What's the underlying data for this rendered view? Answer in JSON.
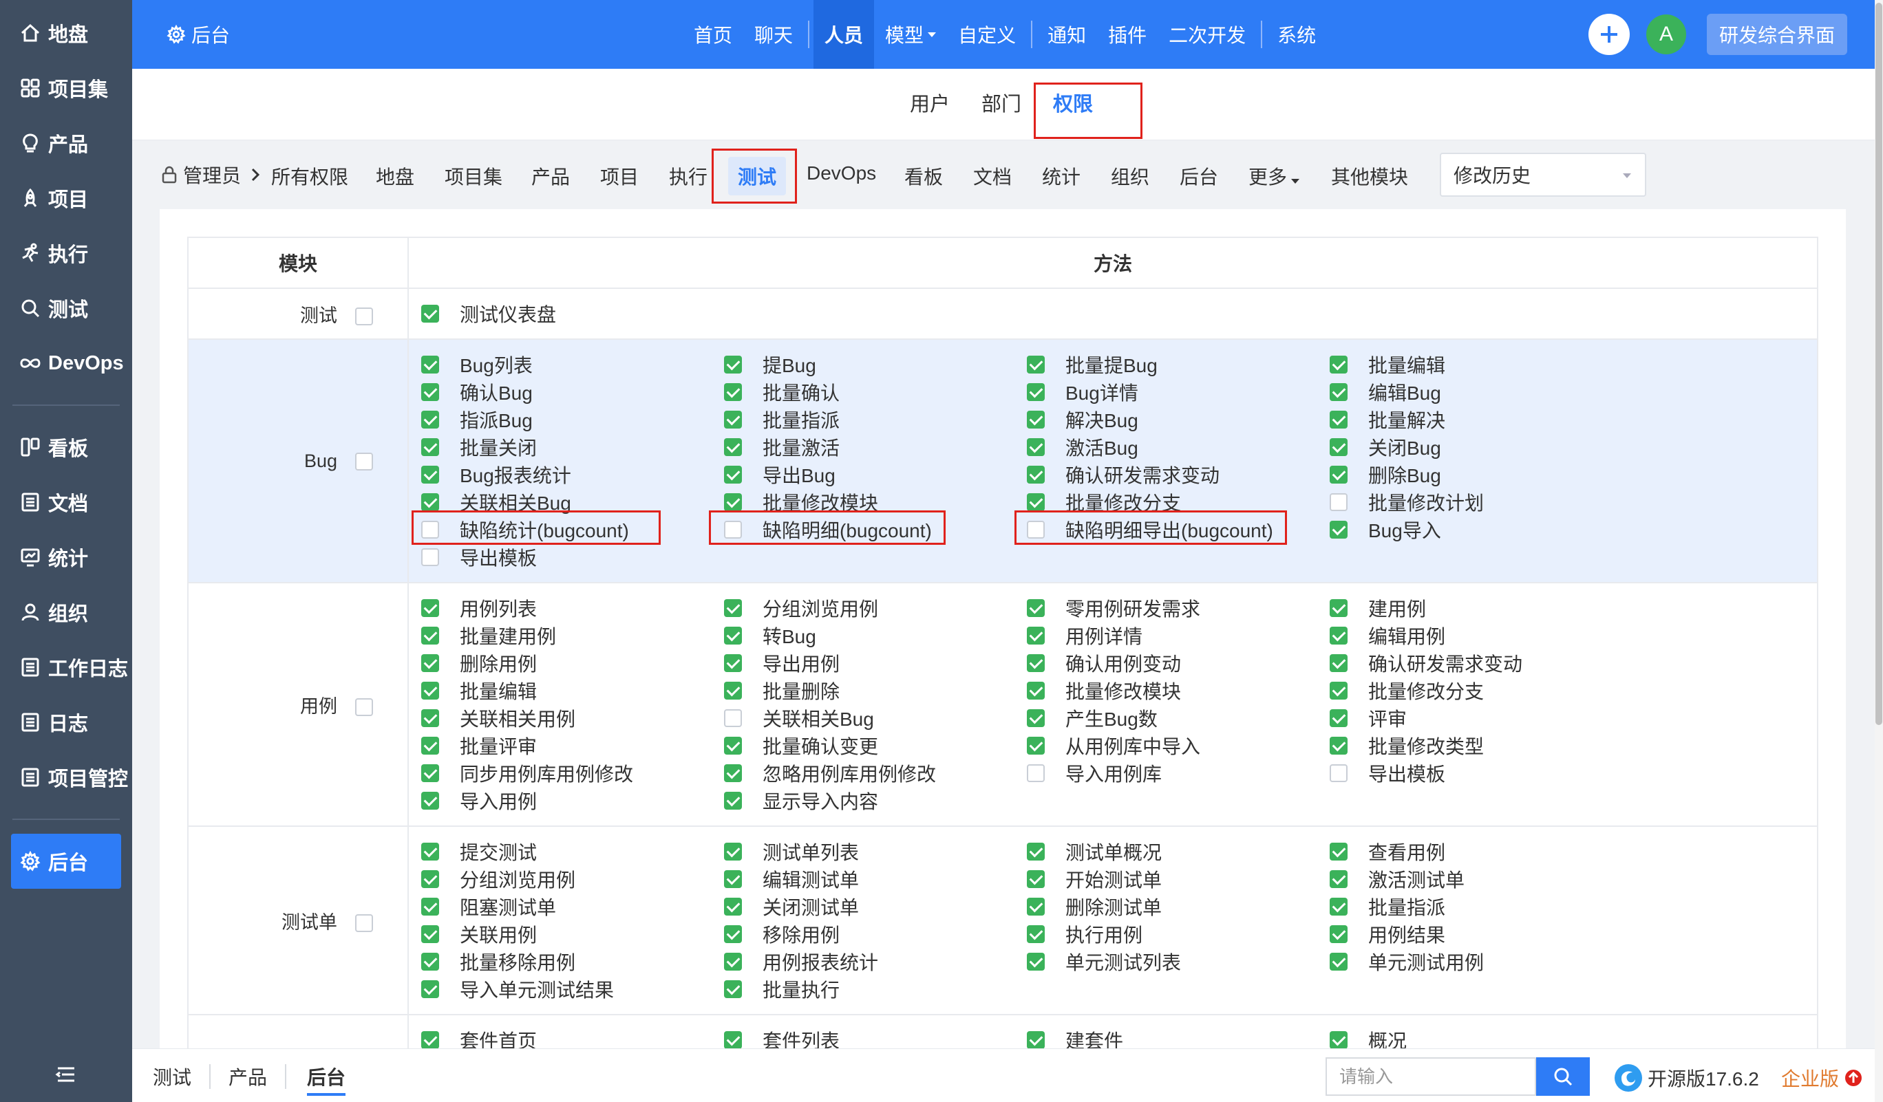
{
  "sidebar": {
    "items": [
      {
        "label": "地盘",
        "icon": "home-icon"
      },
      {
        "label": "项目集",
        "icon": "grid-icon"
      },
      {
        "label": "产品",
        "icon": "lightbulb-icon"
      },
      {
        "label": "项目",
        "icon": "project-icon"
      },
      {
        "label": "执行",
        "icon": "run-icon"
      },
      {
        "label": "测试",
        "icon": "search-icon"
      },
      {
        "label": "DevOps",
        "icon": "infinity-icon"
      },
      {
        "label": "看板",
        "icon": "board-icon"
      },
      {
        "label": "文档",
        "icon": "doc-icon"
      },
      {
        "label": "统计",
        "icon": "monitor-icon"
      },
      {
        "label": "组织",
        "icon": "user-icon"
      },
      {
        "label": "工作日志",
        "icon": "list-icon"
      },
      {
        "label": "日志",
        "icon": "list-icon"
      },
      {
        "label": "项目管控",
        "icon": "list-icon"
      },
      {
        "label": "后台",
        "icon": "gear-icon"
      }
    ],
    "collapse_icon": "menu-collapse-icon"
  },
  "topbar": {
    "backstage_label": "后台",
    "nav": [
      {
        "label": "首页"
      },
      {
        "label": "聊天"
      },
      {
        "label": "人员"
      },
      {
        "label": "模型"
      },
      {
        "label": "自定义"
      },
      {
        "label": "通知"
      },
      {
        "label": "插件"
      },
      {
        "label": "二次开发"
      },
      {
        "label": "系统"
      }
    ],
    "avatar_letter": "A",
    "research_label": "研发综合界面",
    "accent": "#2e7cf6"
  },
  "subtabs": {
    "items": [
      {
        "label": "用户"
      },
      {
        "label": "部门"
      },
      {
        "label": "权限"
      }
    ]
  },
  "modbar": {
    "crumb_label": "管理员",
    "tabs": [
      {
        "label": "所有权限"
      },
      {
        "label": "地盘"
      },
      {
        "label": "项目集"
      },
      {
        "label": "产品"
      },
      {
        "label": "项目"
      },
      {
        "label": "执行"
      },
      {
        "label": "测试"
      },
      {
        "label": "DevOps"
      },
      {
        "label": "看板"
      },
      {
        "label": "文档"
      },
      {
        "label": "统计"
      },
      {
        "label": "组织"
      },
      {
        "label": "后台"
      },
      {
        "label": "更多"
      },
      {
        "label": "其他模块"
      }
    ],
    "history_select": "修改历史"
  },
  "table": {
    "header_module": "模块",
    "header_method": "方法",
    "rows": [
      {
        "module": "测试",
        "checked": false,
        "shaded": false,
        "items": [
          {
            "label": "测试仪表盘",
            "checked": true
          }
        ]
      },
      {
        "module": "Bug",
        "checked": false,
        "shaded": true,
        "items": [
          {
            "label": "Bug列表",
            "checked": true
          },
          {
            "label": "提Bug",
            "checked": true
          },
          {
            "label": "批量提Bug",
            "checked": true
          },
          {
            "label": "批量编辑",
            "checked": true
          },
          {
            "label": "确认Bug",
            "checked": true
          },
          {
            "label": "批量确认",
            "checked": true
          },
          {
            "label": "Bug详情",
            "checked": true
          },
          {
            "label": "编辑Bug",
            "checked": true
          },
          {
            "label": "指派Bug",
            "checked": true
          },
          {
            "label": "批量指派",
            "checked": true
          },
          {
            "label": "解决Bug",
            "checked": true
          },
          {
            "label": "批量解决",
            "checked": true
          },
          {
            "label": "批量关闭",
            "checked": true
          },
          {
            "label": "批量激活",
            "checked": true
          },
          {
            "label": "激活Bug",
            "checked": true
          },
          {
            "label": "关闭Bug",
            "checked": true
          },
          {
            "label": "Bug报表统计",
            "checked": true
          },
          {
            "label": "导出Bug",
            "checked": true
          },
          {
            "label": "确认研发需求变动",
            "checked": true
          },
          {
            "label": "删除Bug",
            "checked": true
          },
          {
            "label": "关联相关Bug",
            "checked": true
          },
          {
            "label": "批量修改模块",
            "checked": true
          },
          {
            "label": "批量修改分支",
            "checked": true
          },
          {
            "label": "批量修改计划",
            "checked": false
          },
          {
            "label": "缺陷统计(bugcount)",
            "checked": false
          },
          {
            "label": "缺陷明细(bugcount)",
            "checked": false
          },
          {
            "label": "缺陷明细导出(bugcount)",
            "checked": false
          },
          {
            "label": "Bug导入",
            "checked": true
          },
          {
            "label": "导出模板",
            "checked": false
          }
        ]
      },
      {
        "module": "用例",
        "checked": false,
        "shaded": false,
        "items": [
          {
            "label": "用例列表",
            "checked": true
          },
          {
            "label": "分组浏览用例",
            "checked": true
          },
          {
            "label": "零用例研发需求",
            "checked": true
          },
          {
            "label": "建用例",
            "checked": true
          },
          {
            "label": "批量建用例",
            "checked": true
          },
          {
            "label": "转Bug",
            "checked": true
          },
          {
            "label": "用例详情",
            "checked": true
          },
          {
            "label": "编辑用例",
            "checked": true
          },
          {
            "label": "删除用例",
            "checked": true
          },
          {
            "label": "导出用例",
            "checked": true
          },
          {
            "label": "确认用例变动",
            "checked": true
          },
          {
            "label": "确认研发需求变动",
            "checked": true
          },
          {
            "label": "批量编辑",
            "checked": true
          },
          {
            "label": "批量删除",
            "checked": true
          },
          {
            "label": "批量修改模块",
            "checked": true
          },
          {
            "label": "批量修改分支",
            "checked": true
          },
          {
            "label": "关联相关用例",
            "checked": true
          },
          {
            "label": "关联相关Bug",
            "checked": false
          },
          {
            "label": "产生Bug数",
            "checked": true
          },
          {
            "label": "评审",
            "checked": true
          },
          {
            "label": "批量评审",
            "checked": true
          },
          {
            "label": "批量确认变更",
            "checked": true
          },
          {
            "label": "从用例库中导入",
            "checked": true
          },
          {
            "label": "批量修改类型",
            "checked": true
          },
          {
            "label": "同步用例库用例修改",
            "checked": true
          },
          {
            "label": "忽略用例库用例修改",
            "checked": true
          },
          {
            "label": "导入用例库",
            "checked": false
          },
          {
            "label": "导出模板",
            "checked": false
          },
          {
            "label": "导入用例",
            "checked": true
          },
          {
            "label": "显示导入内容",
            "checked": true
          }
        ]
      },
      {
        "module": "测试单",
        "checked": false,
        "shaded": false,
        "items": [
          {
            "label": "提交测试",
            "checked": true
          },
          {
            "label": "测试单列表",
            "checked": true
          },
          {
            "label": "测试单概况",
            "checked": true
          },
          {
            "label": "查看用例",
            "checked": true
          },
          {
            "label": "分组浏览用例",
            "checked": true
          },
          {
            "label": "编辑测试单",
            "checked": true
          },
          {
            "label": "开始测试单",
            "checked": true
          },
          {
            "label": "激活测试单",
            "checked": true
          },
          {
            "label": "阻塞测试单",
            "checked": true
          },
          {
            "label": "关闭测试单",
            "checked": true
          },
          {
            "label": "删除测试单",
            "checked": true
          },
          {
            "label": "批量指派",
            "checked": true
          },
          {
            "label": "关联用例",
            "checked": true
          },
          {
            "label": "移除用例",
            "checked": true
          },
          {
            "label": "执行用例",
            "checked": true
          },
          {
            "label": "用例结果",
            "checked": true
          },
          {
            "label": "批量移除用例",
            "checked": true
          },
          {
            "label": "用例报表统计",
            "checked": true
          },
          {
            "label": "单元测试列表",
            "checked": true
          },
          {
            "label": "单元测试用例",
            "checked": true
          },
          {
            "label": "导入单元测试结果",
            "checked": true
          },
          {
            "label": "批量执行",
            "checked": true
          }
        ]
      },
      {
        "module": "",
        "checked": false,
        "shaded": false,
        "items": [
          {
            "label": "套件首页",
            "checked": true
          },
          {
            "label": "套件列表",
            "checked": true
          },
          {
            "label": "建套件",
            "checked": true
          },
          {
            "label": "概况",
            "checked": true
          }
        ]
      }
    ]
  },
  "bottombar": {
    "tabs": [
      {
        "label": "测试"
      },
      {
        "label": "产品"
      },
      {
        "label": "后台"
      }
    ],
    "search_placeholder": "请输入",
    "version": "开源版17.6.2",
    "enterprise": "企业版"
  }
}
